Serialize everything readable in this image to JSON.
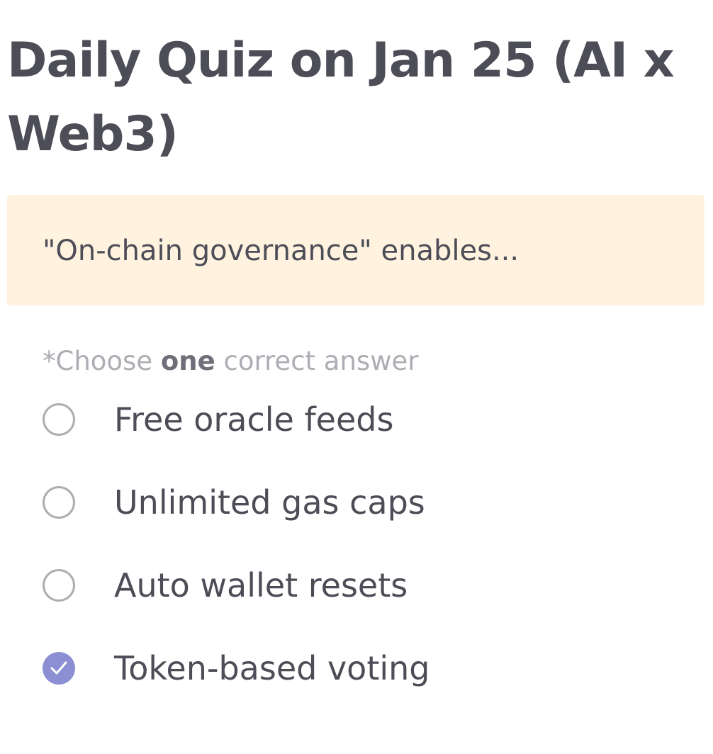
{
  "quiz": {
    "title_line1": "Daily Quiz on Jan 25 (AI x",
    "title_line2": "Web3)",
    "question": "\"On-chain governance\" enables...",
    "instruction": {
      "prefix": "*Choose ",
      "emphasis": "one",
      "suffix": " correct answer"
    },
    "options": [
      {
        "label": "Free oracle feeds",
        "selected": false
      },
      {
        "label": "Unlimited gas caps",
        "selected": false
      },
      {
        "label": "Auto wallet resets",
        "selected": false
      },
      {
        "label": "Token-based voting",
        "selected": true
      }
    ]
  },
  "colors": {
    "accent": "#8c8fd3",
    "question_background": "#fff3e0",
    "text": "#4c4d57",
    "muted": "#adadb4"
  },
  "icons": {
    "selected": "check-icon",
    "unselected": "radio-unchecked-icon"
  }
}
